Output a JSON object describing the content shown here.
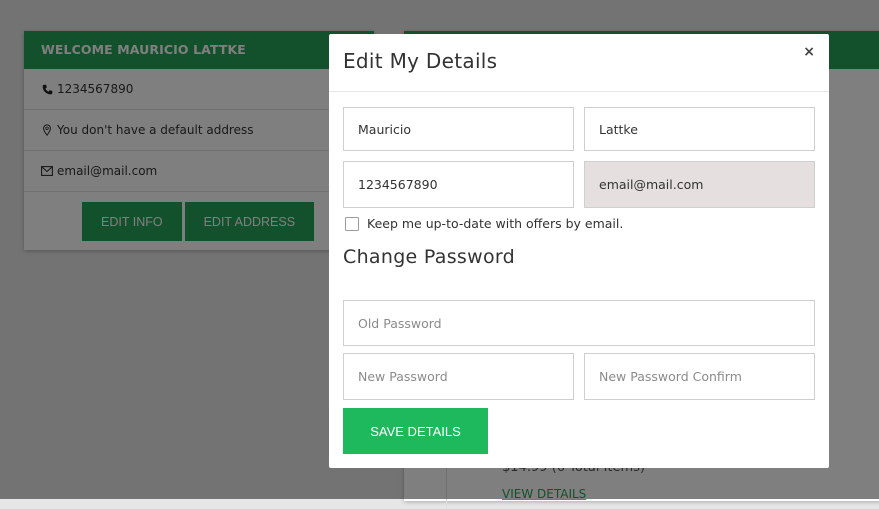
{
  "profile_card": {
    "title": "WELCOME MAURICIO LATTKE",
    "phone": "1234567890",
    "address": "You don't have a default address",
    "email": "email@mail.com",
    "edit_info_label": "EDIT INFO",
    "edit_address_label": "EDIT ADDRESS"
  },
  "orders_card": {
    "price_text": "$14.99 (6 Total Items)",
    "view_details_label": "VIEW DETAILS"
  },
  "modal": {
    "title": "Edit My Details",
    "close_label": "×",
    "first_name": "Mauricio",
    "last_name": "Lattke",
    "phone": "1234567890",
    "email": "email@mail.com",
    "newsletter_label": "Keep me up-to-date with offers by email.",
    "newsletter_checked": false,
    "password_section_title": "Change Password",
    "old_password_placeholder": "Old Password",
    "new_password_placeholder": "New Password",
    "confirm_password_placeholder": "New Password Confirm",
    "save_label": "SAVE DETAILS"
  },
  "colors": {
    "brand_green": "#27a35a",
    "save_green": "#1fb95d",
    "readonly_bg": "#e6dfdf"
  },
  "icons": [
    "phone-icon",
    "map-pin-icon",
    "envelope-icon",
    "close-icon"
  ]
}
